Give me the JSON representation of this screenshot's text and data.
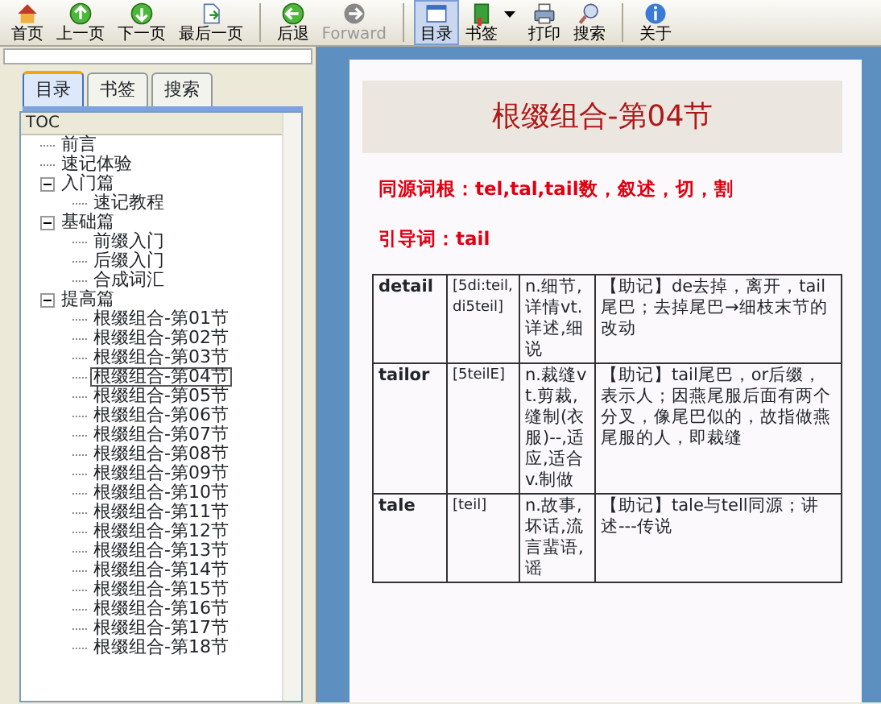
{
  "toolbar": [
    {
      "label": "首页",
      "kind": "home",
      "disabled": false,
      "selected": false,
      "menu": false
    },
    {
      "label": "上一页",
      "kind": "up",
      "disabled": false,
      "selected": false,
      "menu": false
    },
    {
      "label": "下一页",
      "kind": "down",
      "disabled": false,
      "selected": false,
      "menu": false
    },
    {
      "label": "最后一页",
      "kind": "page",
      "disabled": false,
      "selected": false,
      "menu": false
    },
    {
      "label": "后退",
      "kind": "back",
      "disabled": false,
      "selected": false,
      "menu": false
    },
    {
      "label": "Forward",
      "kind": "forward",
      "disabled": true,
      "selected": false,
      "menu": false
    },
    {
      "label": "目录",
      "kind": "window",
      "disabled": false,
      "selected": true,
      "menu": false
    },
    {
      "label": "书签",
      "kind": "book",
      "disabled": false,
      "selected": false,
      "menu": true
    },
    {
      "label": "打印",
      "kind": "printer",
      "disabled": false,
      "selected": false,
      "menu": false
    },
    {
      "label": "搜索",
      "kind": "search",
      "disabled": false,
      "selected": false,
      "menu": false
    },
    {
      "label": "关于",
      "kind": "info",
      "disabled": false,
      "selected": false,
      "menu": false
    }
  ],
  "sidebar": {
    "tabs": [
      {
        "label": "目录",
        "selected": true
      },
      {
        "label": "书签",
        "selected": false
      },
      {
        "label": "搜索",
        "selected": false
      }
    ],
    "tree_header": "TOC",
    "tree": [
      {
        "label": "前言",
        "selected": false
      },
      {
        "label": "速记体验",
        "selected": false
      },
      {
        "label": "入门篇",
        "selected": false,
        "expanded": true,
        "children": [
          {
            "label": "速记教程",
            "selected": false
          }
        ]
      },
      {
        "label": "基础篇",
        "selected": false,
        "expanded": true,
        "children": [
          {
            "label": "前缀入门",
            "selected": false
          },
          {
            "label": "后缀入门",
            "selected": false
          },
          {
            "label": "合成词汇",
            "selected": false
          }
        ]
      },
      {
        "label": "提高篇",
        "selected": false,
        "expanded": true,
        "children": [
          {
            "label": "根缀组合-第01节",
            "selected": false
          },
          {
            "label": "根缀组合-第02节",
            "selected": false
          },
          {
            "label": "根缀组合-第03节",
            "selected": false
          },
          {
            "label": "根缀组合-第04节",
            "selected": true
          },
          {
            "label": "根缀组合-第05节",
            "selected": false
          },
          {
            "label": "根缀组合-第06节",
            "selected": false
          },
          {
            "label": "根缀组合-第07节",
            "selected": false
          },
          {
            "label": "根缀组合-第08节",
            "selected": false
          },
          {
            "label": "根缀组合-第09节",
            "selected": false
          },
          {
            "label": "根缀组合-第10节",
            "selected": false
          },
          {
            "label": "根缀组合-第11节",
            "selected": false
          },
          {
            "label": "根缀组合-第12节",
            "selected": false
          },
          {
            "label": "根缀组合-第13节",
            "selected": false
          },
          {
            "label": "根缀组合-第14节",
            "selected": false
          },
          {
            "label": "根缀组合-第15节",
            "selected": false
          },
          {
            "label": "根缀组合-第16节",
            "selected": false
          },
          {
            "label": "根缀组合-第17节",
            "selected": false
          },
          {
            "label": "根缀组合-第18节",
            "selected": false
          }
        ]
      }
    ]
  },
  "page": {
    "title": "根缀组合-第04节",
    "lines": [
      "同源词根：tel,tal,tail数，叙述，切，割",
      "引导词：tail"
    ],
    "table": [
      {
        "word": "detail",
        "phonetic": "[5di:teil, di5teil]",
        "meaning": "n.细节,详情vt.详述,细说",
        "note": "【助记】de去掉，离开，tail尾巴；去掉尾巴→细枝末节的改动"
      },
      {
        "word": "tailor",
        "phonetic": "[5teilE]",
        "meaning": "n.裁缝vt.剪裁,缝制(衣服)--,适应,适合v.制做",
        "note": "【助记】tail尾巴，or后缀，表示人；因燕尾服后面有两个分叉，像尾巴似的，故指做燕尾服的人，即裁缝"
      },
      {
        "word": "tale",
        "phonetic": "[teil]",
        "meaning": "n.故事,坏话,流言蜚语,谣",
        "note": "【助记】tale与tell同源；讲述---传说"
      }
    ]
  }
}
